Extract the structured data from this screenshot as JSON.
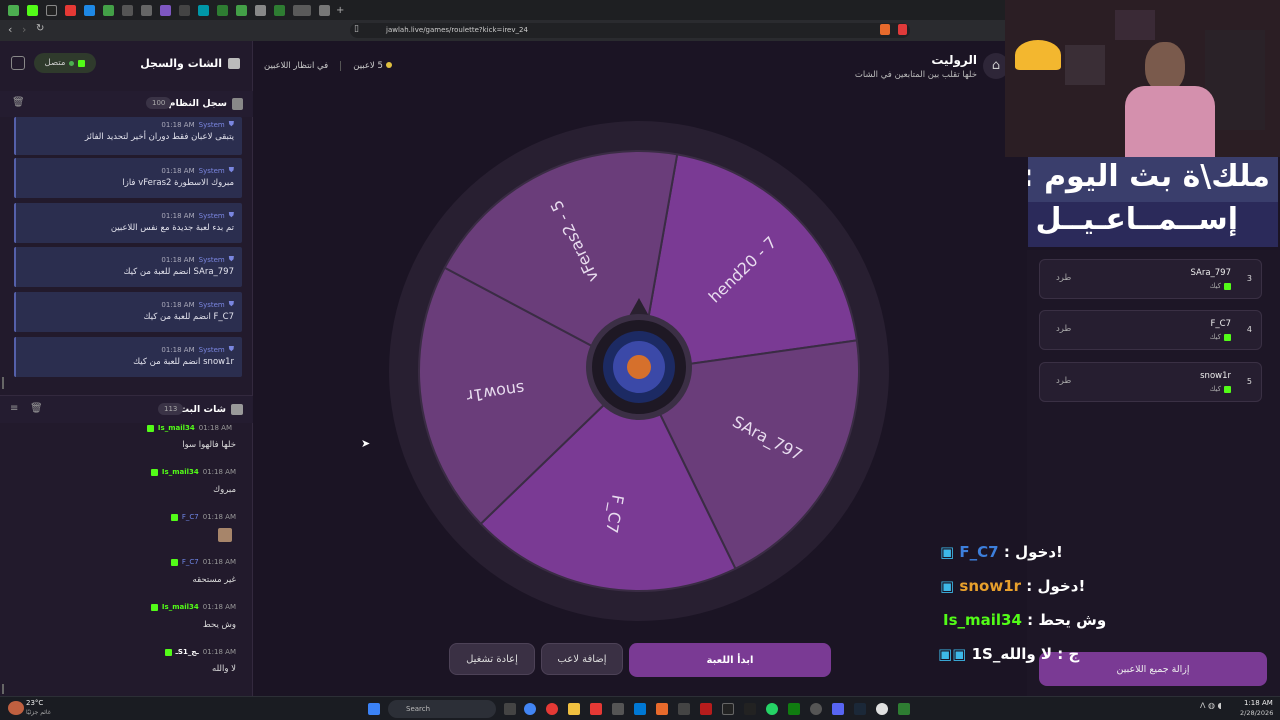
{
  "browser": {
    "url": "jawlah.live/games/roulette?kick=irev_24",
    "tab_active": "roulette"
  },
  "left": {
    "title": "الشات والسجل",
    "status": "متصل",
    "system_log": {
      "title": "سجل النظام",
      "count": "100",
      "entries": [
        {
          "who": "System",
          "time": "01:18 AM",
          "text": "يتبقى لاعبان فقط دوران أخير لتحديد الفائز"
        },
        {
          "who": "System",
          "time": "01:18 AM",
          "text": "مبروك الاسطورة vFeras2 فازا"
        },
        {
          "who": "System",
          "time": "01:18 AM",
          "text": "تم بدء لعبة جديدة مع نفس اللاعبين"
        },
        {
          "who": "System",
          "time": "01:18 AM",
          "text": "SAra_797 انضم للعبة من كيك"
        },
        {
          "who": "System",
          "time": "01:18 AM",
          "text": "F_C7 انضم للعبة من كيك"
        },
        {
          "who": "System",
          "time": "01:18 AM",
          "text": "snow1r انضم للعبة من كيك"
        }
      ]
    },
    "stream_chat": {
      "title": "شات البث",
      "count": "113",
      "messages": [
        {
          "user": "Is_mail34",
          "time": "01:18 AM",
          "text": "خلها فالهوا سوا"
        },
        {
          "user": "Is_mail34",
          "time": "01:18 AM",
          "text": "مبروك"
        },
        {
          "user": "F_C7",
          "time": "01:18 AM",
          "text": ""
        },
        {
          "user": "F_C7",
          "time": "01:18 AM",
          "text": "غير مستحقه"
        },
        {
          "user": "Is_mail34",
          "time": "01:18 AM",
          "text": "وش يحط"
        },
        {
          "user": "ـS1_ـج",
          "time": "01:18 AM",
          "text": "لا والله"
        }
      ]
    }
  },
  "main": {
    "title": "الروليت",
    "subtitle": "خلها تقلب بين المتابعين في الشات",
    "waiting": "في انتظار اللاعبين",
    "players_count": "5 لاعبين",
    "wheel": {
      "segments": [
        {
          "label": "hend20 - 7",
          "color": "#7a3a94"
        },
        {
          "label": "SAra_797",
          "color": "#6a3d7a"
        },
        {
          "label": "F_C7",
          "color": "#7a3a94"
        },
        {
          "label": "snow1r",
          "color": "#6a3d7a"
        },
        {
          "label": "vFeras2 - 5",
          "color": "#6a3d7a"
        }
      ]
    },
    "buttons": {
      "start": "ابدأ اللعبة",
      "add": "إضافة لاعب",
      "restart": "إعادة تشغيل"
    }
  },
  "right": {
    "banner_line1": "ملك\\ة بث اليوم :",
    "banner_line2": "إســمــاعـيــل",
    "players": [
      {
        "num": "3",
        "name": "SAra_797",
        "src": "كيك",
        "action": "طرد"
      },
      {
        "num": "4",
        "name": "F_C7",
        "src": "كيك",
        "action": "طرد"
      },
      {
        "num": "5",
        "name": "snow1r",
        "src": "كيك",
        "action": "طرد"
      }
    ],
    "remove_all": "إزالة جميع اللاعبين"
  },
  "overlay_chat": [
    {
      "user": "F_C7",
      "text": "دخول!",
      "color": "#3d7fdc"
    },
    {
      "user": "snow1r",
      "text": "دخول!",
      "color": "#e8a02c"
    },
    {
      "user": "Is_mail34",
      "text": "وش يحط",
      "color": "#53fc18"
    },
    {
      "user": "1S_ج",
      "text": "لا والله",
      "color": "#ffffff"
    }
  ],
  "taskbar": {
    "weather": "23°C",
    "weather_sub": "غائم جزئيًا",
    "search": "Search",
    "time": "1:18 AM",
    "date": "2/28/2026"
  }
}
